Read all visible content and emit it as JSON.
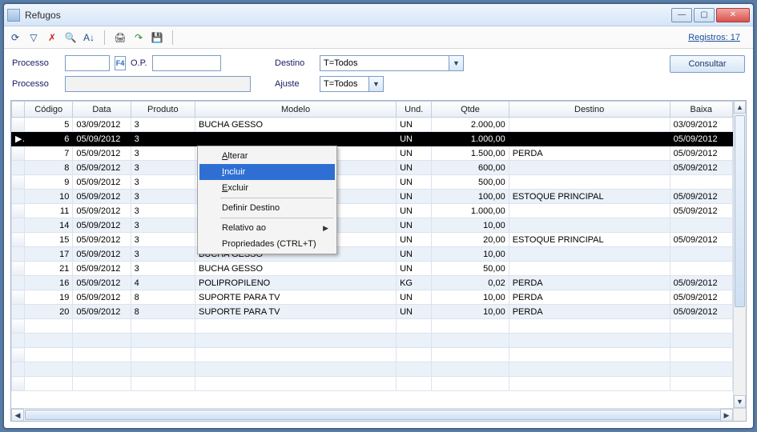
{
  "window": {
    "title": "Refugos"
  },
  "toolbar": {
    "registros_label": "Registros: 17"
  },
  "filters": {
    "processo_label": "Processo",
    "op_label": "O.P.",
    "processo2_label": "Processo",
    "destino_label": "Destino",
    "ajuste_label": "Ajuste",
    "destino_value": "T=Todos",
    "ajuste_value": "T=Todos",
    "consultar_label": "Consultar",
    "f4_label": "F4"
  },
  "grid": {
    "headers": {
      "codigo": "Código",
      "data": "Data",
      "produto": "Produto",
      "modelo": "Modelo",
      "und": "Und.",
      "qtde": "Qtde",
      "destino": "Destino",
      "baixa": "Baixa"
    },
    "rows": [
      {
        "codigo": "5",
        "data": "03/09/2012",
        "produto": "3",
        "modelo": "BUCHA GESSO",
        "und": "UN",
        "qtde": "2.000,00",
        "destino": "",
        "baixa": "03/09/2012"
      },
      {
        "codigo": "6",
        "data": "05/09/2012",
        "produto": "3",
        "modelo": "",
        "und": "UN",
        "qtde": "1.000,00",
        "destino": "",
        "baixa": "05/09/2012",
        "selected": true
      },
      {
        "codigo": "7",
        "data": "05/09/2012",
        "produto": "3",
        "modelo": "",
        "und": "UN",
        "qtde": "1.500,00",
        "destino": "PERDA",
        "baixa": "05/09/2012"
      },
      {
        "codigo": "8",
        "data": "05/09/2012",
        "produto": "3",
        "modelo": "",
        "und": "UN",
        "qtde": "600,00",
        "destino": "",
        "baixa": "05/09/2012"
      },
      {
        "codigo": "9",
        "data": "05/09/2012",
        "produto": "3",
        "modelo": "",
        "und": "UN",
        "qtde": "500,00",
        "destino": "",
        "baixa": ""
      },
      {
        "codigo": "10",
        "data": "05/09/2012",
        "produto": "3",
        "modelo": "",
        "und": "UN",
        "qtde": "100,00",
        "destino": "ESTOQUE PRINCIPAL",
        "baixa": "05/09/2012"
      },
      {
        "codigo": "11",
        "data": "05/09/2012",
        "produto": "3",
        "modelo": "",
        "und": "UN",
        "qtde": "1.000,00",
        "destino": "",
        "baixa": "05/09/2012"
      },
      {
        "codigo": "14",
        "data": "05/09/2012",
        "produto": "3",
        "modelo": "",
        "und": "UN",
        "qtde": "10,00",
        "destino": "",
        "baixa": ""
      },
      {
        "codigo": "15",
        "data": "05/09/2012",
        "produto": "3",
        "modelo": "",
        "und": "UN",
        "qtde": "20,00",
        "destino": "ESTOQUE PRINCIPAL",
        "baixa": "05/09/2012"
      },
      {
        "codigo": "17",
        "data": "05/09/2012",
        "produto": "3",
        "modelo": "BUCHA GESSO",
        "und": "UN",
        "qtde": "10,00",
        "destino": "",
        "baixa": ""
      },
      {
        "codigo": "21",
        "data": "05/09/2012",
        "produto": "3",
        "modelo": "BUCHA GESSO",
        "und": "UN",
        "qtde": "50,00",
        "destino": "",
        "baixa": ""
      },
      {
        "codigo": "16",
        "data": "05/09/2012",
        "produto": "4",
        "modelo": "POLIPROPILENO",
        "und": "KG",
        "qtde": "0,02",
        "destino": "PERDA",
        "baixa": "05/09/2012"
      },
      {
        "codigo": "19",
        "data": "05/09/2012",
        "produto": "8",
        "modelo": "SUPORTE PARA TV",
        "und": "UN",
        "qtde": "10,00",
        "destino": "PERDA",
        "baixa": "05/09/2012"
      },
      {
        "codigo": "20",
        "data": "05/09/2012",
        "produto": "8",
        "modelo": "SUPORTE PARA TV",
        "und": "UN",
        "qtde": "10,00",
        "destino": "PERDA",
        "baixa": "05/09/2012"
      }
    ]
  },
  "context_menu": {
    "alterar": "Alterar",
    "incluir": "Incluir",
    "excluir": "Excluir",
    "definir_destino": "Definir Destino",
    "relativo": "Relativo ao",
    "propriedades": "Propriedades (CTRL+T)"
  }
}
